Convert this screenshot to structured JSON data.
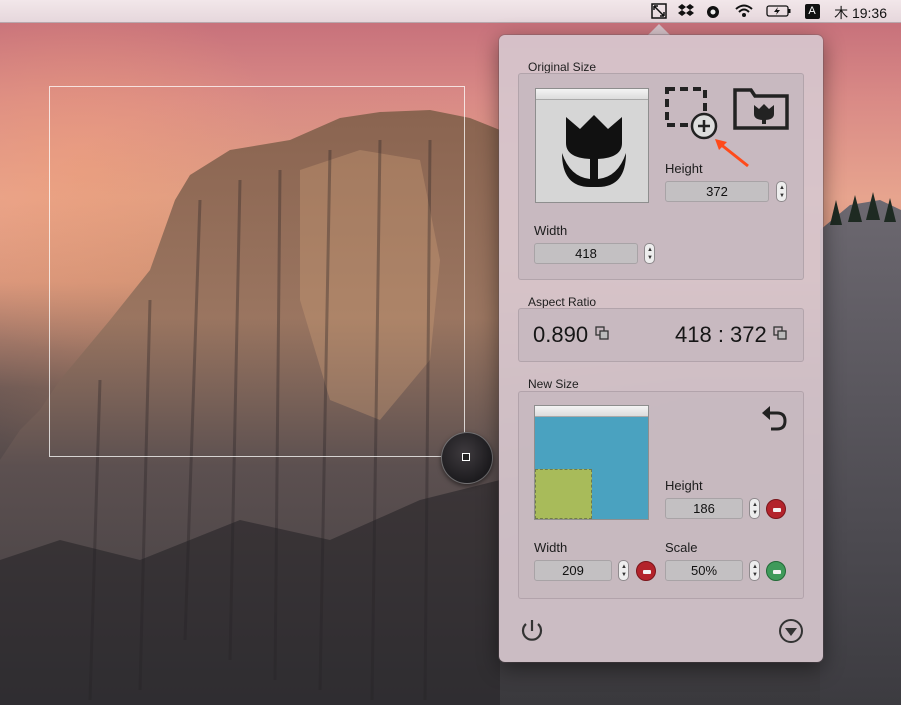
{
  "menubar": {
    "input_indicator": "A",
    "clock": "木 19:36"
  },
  "original": {
    "title": "Original Size",
    "height_label": "Height",
    "height_value": "372",
    "width_label": "Width",
    "width_value": "418"
  },
  "aspect": {
    "title": "Aspect Ratio",
    "ratio": "0.890",
    "dimensions": "418 : 372"
  },
  "new_size": {
    "title": "New Size",
    "height_label": "Height",
    "height_value": "186",
    "width_label": "Width",
    "width_value": "209",
    "scale_label": "Scale",
    "scale_value": "50%"
  },
  "colors": {
    "remove_red": "#b3232b",
    "add_green": "#3f9a5a",
    "preview_blue": "#4aa2c0",
    "preview_green": "#a8bb5a",
    "annotation_arrow": "#ff4a1a"
  }
}
